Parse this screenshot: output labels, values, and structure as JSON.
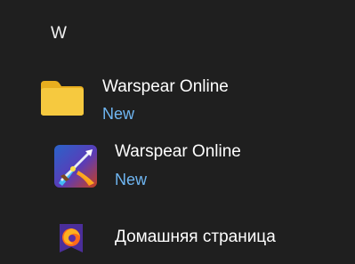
{
  "section": {
    "letter": "W"
  },
  "items": [
    {
      "title": "Warspear Online",
      "badge": "New",
      "icon": "folder-icon"
    },
    {
      "title": "Warspear Online",
      "badge": "New",
      "icon": "warspear-app-icon"
    },
    {
      "title": "Домашняя страница",
      "icon": "firefox-icon"
    }
  ],
  "colors": {
    "background": "#1f1f1f",
    "new_badge": "#6fb6f2",
    "folder": "#f4c430"
  }
}
